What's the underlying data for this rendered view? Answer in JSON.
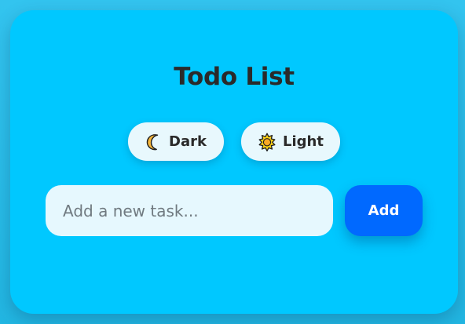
{
  "app": {
    "title": "Todo List"
  },
  "theme": {
    "dark_label": "Dark",
    "dark_icon": "crescent-moon-icon",
    "light_label": "Light",
    "light_icon": "sun-icon"
  },
  "task_form": {
    "input_value": "",
    "input_placeholder": "Add a new task...",
    "add_label": "Add"
  },
  "colors": {
    "background": "#2bbde8",
    "card": "#00c8ff",
    "theme_button": "#e8f8fd",
    "input": "#e6f8fe",
    "add_button": "#0069ff",
    "title_text": "#2a2a2a",
    "moon": "#f6b73c",
    "sun": "#fcd116"
  }
}
